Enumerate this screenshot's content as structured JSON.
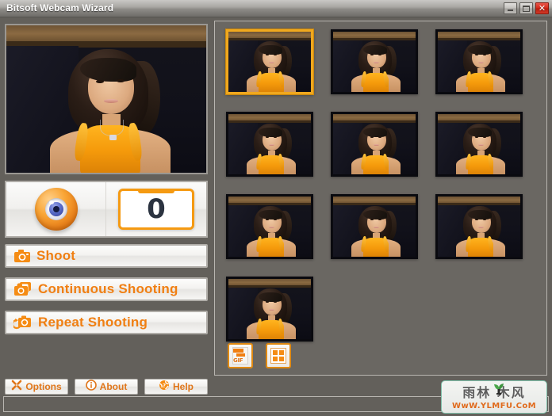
{
  "window": {
    "title": "Bitsoft Webcam Wizard",
    "controls": [
      {
        "name": "minimize",
        "glyph": "minimize-icon"
      },
      {
        "name": "maximize",
        "glyph": "maximize-icon"
      },
      {
        "name": "close",
        "glyph": "close-icon",
        "label": "✕"
      }
    ]
  },
  "left": {
    "preview_label": "webcam-preview",
    "counter": {
      "icon": "eye-icon",
      "value": "0"
    },
    "actions": [
      {
        "id": "shoot",
        "label": "Shoot",
        "icon": "camera-icon"
      },
      {
        "id": "continuous",
        "label": "Continuous Shooting",
        "icon": "camera-stack-icon"
      },
      {
        "id": "repeat",
        "label": "Repeat Shooting",
        "icon": "camera-repeat-icon"
      }
    ],
    "small_buttons": [
      {
        "id": "options",
        "label": "Options",
        "icon": "tools-icon"
      },
      {
        "id": "about",
        "label": "About",
        "icon": "info-icon"
      },
      {
        "id": "help",
        "label": "Help",
        "icon": "help-globe-icon"
      }
    ]
  },
  "right": {
    "thumbnails": [
      {
        "index": 1,
        "selected": true
      },
      {
        "index": 2,
        "selected": false
      },
      {
        "index": 3,
        "selected": false
      },
      {
        "index": 4,
        "selected": false
      },
      {
        "index": 5,
        "selected": false
      },
      {
        "index": 6,
        "selected": false
      },
      {
        "index": 7,
        "selected": false
      },
      {
        "index": 8,
        "selected": false
      },
      {
        "index": 9,
        "selected": false
      },
      {
        "index": 10,
        "selected": false
      }
    ],
    "tools": [
      {
        "id": "make-gif",
        "icon": "gif-file-icon",
        "label": "GIF"
      },
      {
        "id": "grid-view",
        "icon": "grid-four-icon"
      }
    ]
  },
  "statusbar": {
    "text": ""
  },
  "watermark": {
    "chinese": "雨林  木风",
    "url": "WwW.YLMFU.CoM"
  },
  "colors": {
    "window_bg": "#63605b",
    "titlebar_top": "#c9c8c5",
    "accent_orange": "#f07f12",
    "selection_gold": "#f0a81e",
    "close_red": "#d62a19",
    "panel_border": "#b9b6b1",
    "counter_text": "#2b3340"
  }
}
